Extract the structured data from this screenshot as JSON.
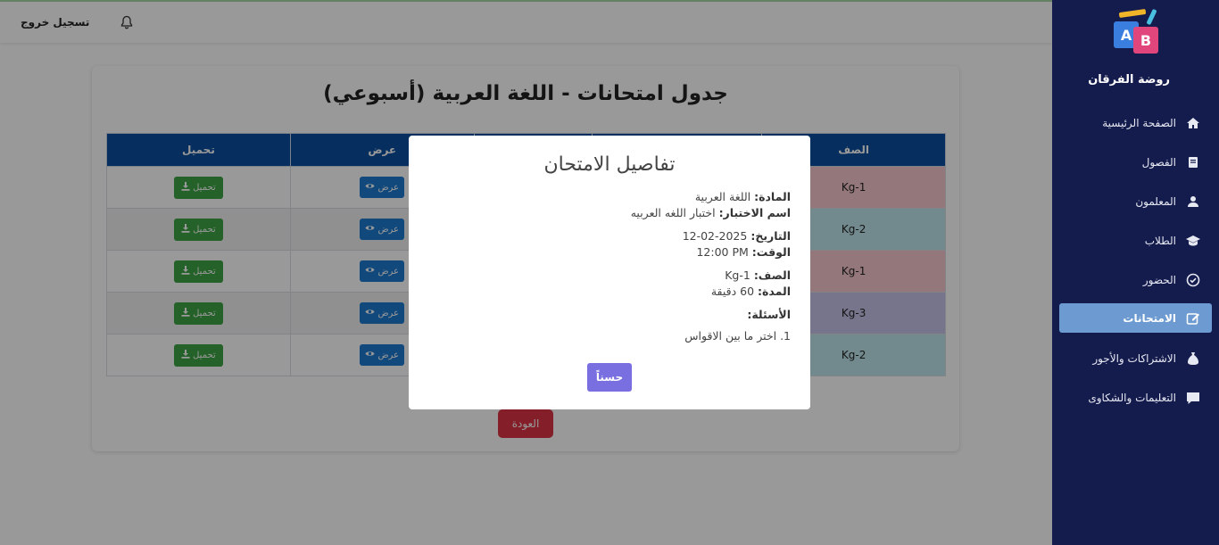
{
  "sidebar": {
    "school_name": "روضة الفرقان",
    "items": [
      {
        "label": "الصفحة الرئيسية",
        "icon": "home-icon"
      },
      {
        "label": "الفصول",
        "icon": "book-icon"
      },
      {
        "label": "المعلمون",
        "icon": "user-icon"
      },
      {
        "label": "الطلاب",
        "icon": "graduation-cap-icon"
      },
      {
        "label": "الحضور",
        "icon": "check-circle-icon"
      },
      {
        "label": "الامتحانات",
        "icon": "edit-icon",
        "active": true
      },
      {
        "label": "الاشتراكات والأجور",
        "icon": "money-bag-icon"
      },
      {
        "label": "التعليمات والشكاوى",
        "icon": "comment-icon"
      }
    ]
  },
  "topbar": {
    "logout_label": "تسجيل خروج"
  },
  "card": {
    "title": "جدول امتحانات - اللغة العربية (أسبوعي)",
    "columns": {
      "class": "الصف",
      "view": "عرض",
      "download": "تحميل"
    },
    "rows": [
      {
        "class": "Kg-1",
        "color": "#f5c6cb",
        "view": "عرض",
        "download": "تحميل"
      },
      {
        "class": "Kg-2",
        "color": "#bee5eb",
        "view": "عرض",
        "download": "تحميل"
      },
      {
        "class": "Kg-1",
        "color": "#f5c6cb",
        "view": "عرض",
        "download": "تحميل"
      },
      {
        "class": "Kg-3",
        "color": "#c5c3e8",
        "view": "عرض",
        "download": "تحميل"
      },
      {
        "class": "Kg-2",
        "color": "#bee5eb",
        "view": "عرض",
        "download": "تحميل"
      }
    ],
    "back_label": "العودة"
  },
  "modal": {
    "title": "تفاصيل الامتحان",
    "subject_label": "المادة:",
    "subject_value": "اللغة العربية",
    "exam_name_label": "اسم الاختبار:",
    "exam_name_value": "اختبار اللغه العربيه",
    "date_label": "التاريخ:",
    "date_value": "2025-02-12",
    "time_label": "الوقت:",
    "time_value": "12:00 PM",
    "class_label": "الصف:",
    "class_value": "Kg-1",
    "duration_label": "المدة:",
    "duration_value": "60 دقيقة",
    "questions_label": "الأسئلة:",
    "questions": [
      "1. اختر ما بين الاقواس"
    ],
    "ok_label": "حسناً"
  },
  "colors": {
    "sidebar_bg": "#141b4d",
    "table_header": "#0a4f9e",
    "view_button": "#1e7bd0",
    "download_button": "#3da345",
    "back_button": "#dc3545",
    "ok_button": "#7a6fe0",
    "active_nav": "#6d9bd1"
  }
}
